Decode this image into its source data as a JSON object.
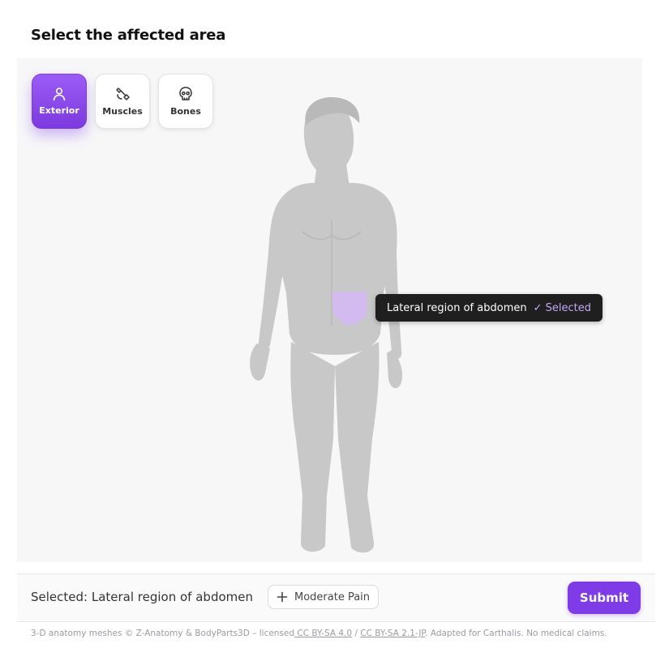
{
  "page": {
    "title": "Select the affected area"
  },
  "modes": [
    {
      "label": "Exterior",
      "icon": "person-icon",
      "active": true
    },
    {
      "label": "Muscles",
      "icon": "muscle-icon",
      "active": false
    },
    {
      "label": "Bones",
      "icon": "skull-icon",
      "active": false
    }
  ],
  "model": {
    "highlighted_region": "Lateral region of abdomen",
    "highlight_color": "#d5b8f7"
  },
  "tooltip": {
    "region": "Lateral region of abdomen",
    "status": "✓ Selected"
  },
  "bottom": {
    "selected_text": "Selected: Lateral region of abdomen",
    "pain_chip": "Moderate Pain",
    "pain_icon": "plus-icon",
    "submit_label": "Submit"
  },
  "footer": {
    "prefix": "3-D anatomy meshes © Z-Anatomy & BodyParts3D – licensed",
    "link1": " CC BY-SA 4.0",
    "separator": " / ",
    "link2": "CC BY-SA 2.1-JP",
    "suffix": ". Adapted for Carthalis. No medical claims."
  },
  "colors": {
    "accent": "#7f3be6",
    "tooltip_bg": "#1f1f1f",
    "viewer_bg": "#f7f7f8"
  }
}
